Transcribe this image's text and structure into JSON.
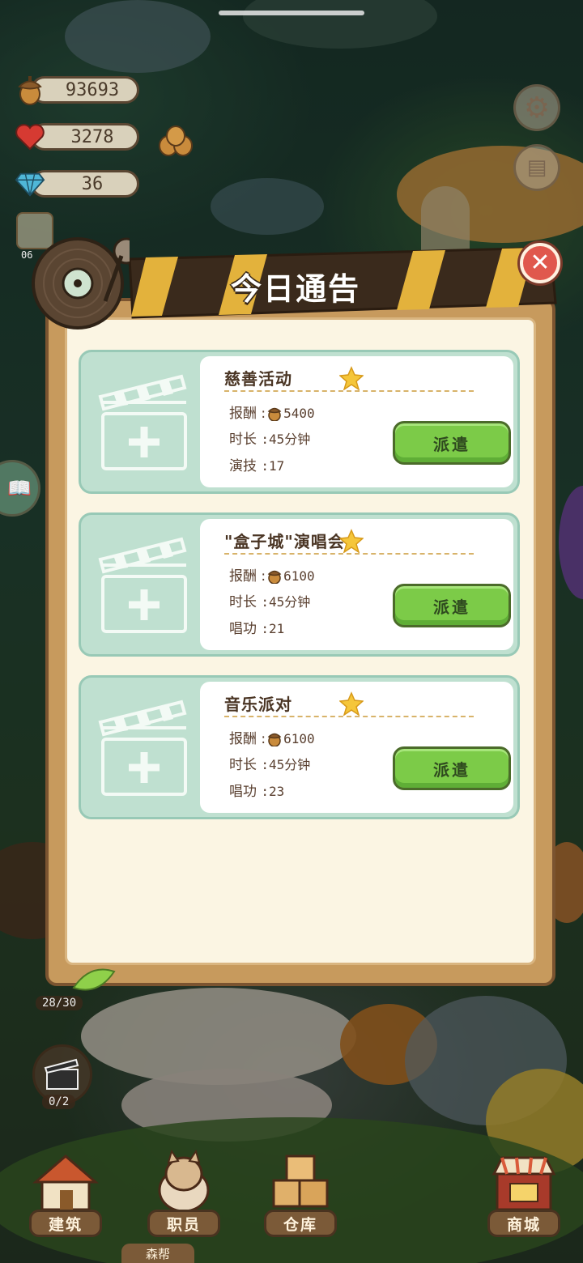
{
  "resources": {
    "acorns": "93693",
    "hearts": "3278",
    "diamonds": "36",
    "timer_partial": "06"
  },
  "dialog": {
    "title": "今日通告",
    "close_icon": "close-x-icon"
  },
  "labels": {
    "reward": "报酬",
    "duration": "时长"
  },
  "cards": [
    {
      "title": "慈善活动",
      "reward": "5400",
      "duration": ":45分钟",
      "skill_label": "演技",
      "skill_value": ":17",
      "button": "派遣"
    },
    {
      "title": "\"盒子城\"演唱会",
      "reward": "6100",
      "duration": ":45分钟",
      "skill_label": "唱功",
      "skill_value": ":21",
      "button": "派遣"
    },
    {
      "title": "音乐派对",
      "reward": "6100",
      "duration": ":45分钟",
      "skill_label": "唱功",
      "skill_value": ":23",
      "button": "派遣"
    }
  ],
  "badges": {
    "capacity": "28/30",
    "clapper_count": "0/2"
  },
  "nav": {
    "build": "建筑",
    "staff": "职员",
    "warehouse": "仓库",
    "shop": "商城",
    "bottom_tab": "森帮"
  },
  "colors": {
    "panel_border": "#7b5430",
    "card_bg": "#bfe0d0",
    "dispatch_green": "#7ccb48",
    "title_text": "#ffffff"
  }
}
